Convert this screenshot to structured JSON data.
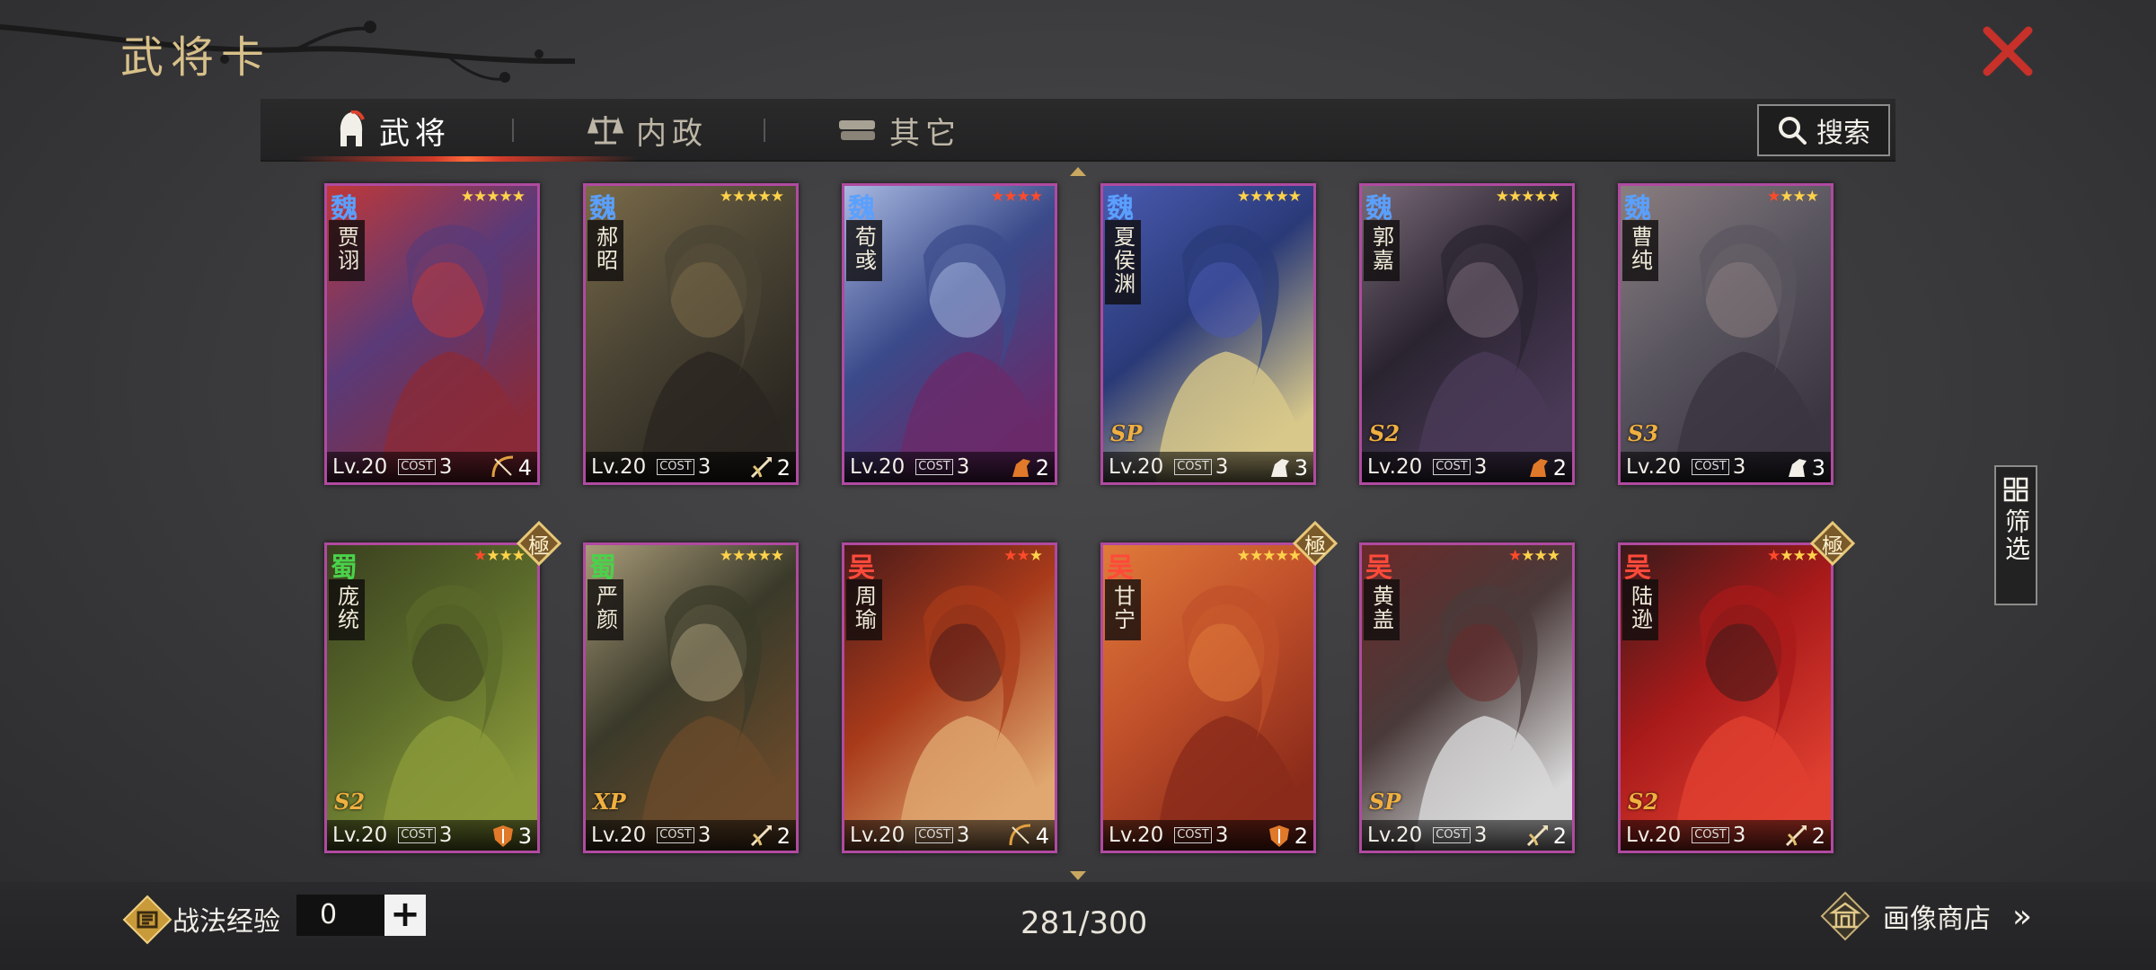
{
  "title": "武将卡",
  "tabs": [
    {
      "label": "武将",
      "icon": "general-helmet-icon",
      "active": true
    },
    {
      "label": "内政",
      "icon": "politics-icon",
      "active": false
    },
    {
      "label": "其它",
      "icon": "scroll-stack-icon",
      "active": false
    }
  ],
  "search": {
    "label": "搜索"
  },
  "filter": {
    "label": "筛选"
  },
  "cards": [
    {
      "kingdom": "魏",
      "name": "贾诩",
      "level": "Lv.20",
      "cost_label": "COST",
      "cost": "3",
      "troop_count": "4",
      "troop_type": "bow-icon",
      "stars": 5,
      "red_stars": 0,
      "season": "",
      "elite": false,
      "colors": [
        "#5a3a78",
        "#8a2a38",
        "#c03838"
      ]
    },
    {
      "kingdom": "魏",
      "name": "郝昭",
      "level": "Lv.20",
      "cost_label": "COST",
      "cost": "3",
      "troop_count": "2",
      "troop_type": "spear-icon",
      "stars": 5,
      "red_stars": 0,
      "season": "",
      "elite": false,
      "colors": [
        "#4a4434",
        "#2a2620",
        "#7a6a48"
      ]
    },
    {
      "kingdom": "魏",
      "name": "荀彧",
      "level": "Lv.20",
      "cost_label": "COST",
      "cost": "3",
      "troop_count": "2",
      "troop_type": "cavalry-icon",
      "stars": 4,
      "red_stars": 4,
      "season": "",
      "elite": false,
      "colors": [
        "#3a4a8a",
        "#6a2a6a",
        "#a8b8e0"
      ]
    },
    {
      "kingdom": "魏",
      "name": "夏侯渊",
      "level": "Lv.20",
      "cost_label": "COST",
      "cost": "3",
      "troop_count": "3",
      "troop_type": "horse-icon",
      "stars": 5,
      "red_stars": 0,
      "season": "SP",
      "elite": false,
      "colors": [
        "#2a3a78",
        "#d8c88a",
        "#4a5ab0"
      ]
    },
    {
      "kingdom": "魏",
      "name": "郭嘉",
      "level": "Lv.20",
      "cost_label": "COST",
      "cost": "3",
      "troop_count": "2",
      "troop_type": "cavalry-icon",
      "stars": 5,
      "red_stars": 0,
      "season": "S2",
      "elite": false,
      "colors": [
        "#2a2430",
        "#4a3a58",
        "#7a6a78"
      ]
    },
    {
      "kingdom": "魏",
      "name": "曹纯",
      "level": "Lv.20",
      "cost_label": "COST",
      "cost": "3",
      "troop_count": "3",
      "troop_type": "horse-icon",
      "stars": 4,
      "red_stars": 1,
      "season": "S3",
      "elite": false,
      "colors": [
        "#5a5660",
        "#3a3540",
        "#8a7e80"
      ]
    },
    {
      "kingdom": "蜀",
      "name": "庞统",
      "level": "Lv.20",
      "cost_label": "COST",
      "cost": "3",
      "troop_count": "3",
      "troop_type": "shield-icon",
      "stars": 4,
      "red_stars": 1,
      "season": "S2",
      "elite": true,
      "colors": [
        "#5a6a2a",
        "#8a9a3a",
        "#3a4020"
      ]
    },
    {
      "kingdom": "蜀",
      "name": "严颜",
      "level": "Lv.20",
      "cost_label": "COST",
      "cost": "3",
      "troop_count": "2",
      "troop_type": "spear-icon",
      "stars": 5,
      "red_stars": 0,
      "season": "XP",
      "elite": false,
      "colors": [
        "#3a3a2a",
        "#6a4a2a",
        "#a89a78"
      ]
    },
    {
      "kingdom": "吴",
      "name": "周瑜",
      "level": "Lv.20",
      "cost_label": "COST",
      "cost": "3",
      "troop_count": "4",
      "troop_type": "bow-icon",
      "stars": 3,
      "red_stars": 2,
      "season": "",
      "elite": false,
      "colors": [
        "#a83a1a",
        "#e0a870",
        "#4a1a1a"
      ]
    },
    {
      "kingdom": "吴",
      "name": "甘宁",
      "level": "Lv.20",
      "cost_label": "COST",
      "cost": "3",
      "troop_count": "2",
      "troop_type": "shield-icon",
      "stars": 5,
      "red_stars": 0,
      "season": "",
      "elite": true,
      "colors": [
        "#c0502a",
        "#8a2a1a",
        "#e07a3a"
      ]
    },
    {
      "kingdom": "吴",
      "name": "黄盖",
      "level": "Lv.20",
      "cost_label": "COST",
      "cost": "3",
      "troop_count": "2",
      "troop_type": "spear-icon",
      "stars": 4,
      "red_stars": 1,
      "season": "SP",
      "elite": false,
      "colors": [
        "#4a3a3a",
        "#d8d8d8",
        "#6a2a2a"
      ]
    },
    {
      "kingdom": "吴",
      "name": "陆逊",
      "level": "Lv.20",
      "cost_label": "COST",
      "cost": "3",
      "troop_count": "2",
      "troop_type": "spear-icon",
      "stars": 4,
      "red_stars": 1,
      "season": "S2",
      "elite": true,
      "colors": [
        "#a81a1a",
        "#e04030",
        "#3a1a1a"
      ]
    }
  ],
  "elite_label": "極",
  "bottom": {
    "exp_label": "战法经验",
    "exp_value": "0",
    "plus": "+",
    "count": "281/300",
    "shop_label": "画像商店",
    "shop_arrow": "»"
  },
  "colors": {
    "wei": "#5aa0ff",
    "shu": "#4ad24a",
    "wu": "#ff4a3a",
    "card_border": "#b04aa0",
    "accent_gold": "#d8c08a",
    "close_red": "#c8302a"
  }
}
